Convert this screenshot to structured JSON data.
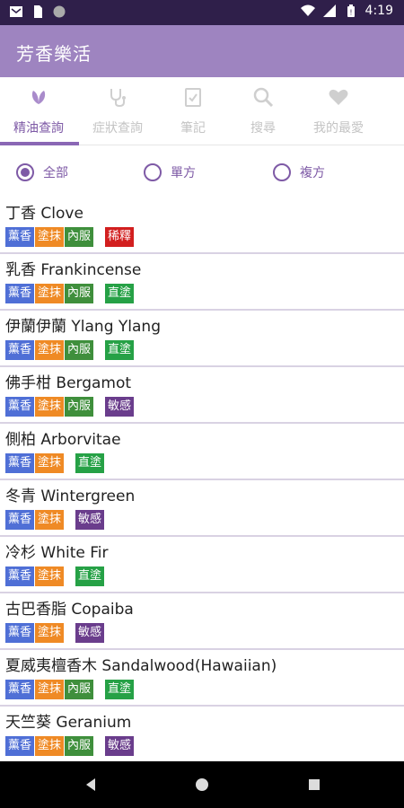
{
  "status_bar": {
    "time": "4:19",
    "left_icons": [
      "mail-icon",
      "sim-card-icon",
      "circle-icon"
    ],
    "right_icons": [
      "wifi-icon",
      "signal-icon",
      "battery-icon"
    ]
  },
  "app_bar": {
    "title": "芳香樂活",
    "color": "#9e84c0"
  },
  "tabs": [
    {
      "label": "精油查詢",
      "icon": "leaf-icon",
      "active": true
    },
    {
      "label": "症狀查詢",
      "icon": "stethoscope-icon",
      "active": false
    },
    {
      "label": "筆記",
      "icon": "notepad-icon",
      "active": false
    },
    {
      "label": "搜尋",
      "icon": "search-icon",
      "active": false
    },
    {
      "label": "我的最愛",
      "icon": "heart-icon",
      "active": false
    }
  ],
  "filter": {
    "options": [
      {
        "label": "全部",
        "checked": true
      },
      {
        "label": "單方",
        "checked": false
      },
      {
        "label": "複方",
        "checked": false
      }
    ]
  },
  "tag_colors": {
    "薰香": "#4f6fd6",
    "塗抹": "#ef8a25",
    "內服": "#3f8f3c",
    "稀釋": "#d21f1f",
    "直塗": "#26a146",
    "敏感": "#6a3d8c"
  },
  "oils": [
    {
      "name": "丁香 Clove",
      "tags": [
        "薰香",
        "塗抹",
        "內服"
      ],
      "note": "稀釋"
    },
    {
      "name": "乳香 Frankincense",
      "tags": [
        "薰香",
        "塗抹",
        "內服"
      ],
      "note": "直塗"
    },
    {
      "name": "伊蘭伊蘭 Ylang Ylang",
      "tags": [
        "薰香",
        "塗抹",
        "內服"
      ],
      "note": "直塗"
    },
    {
      "name": "佛手柑 Bergamot",
      "tags": [
        "薰香",
        "塗抹",
        "內服"
      ],
      "note": "敏感"
    },
    {
      "name": "側柏 Arborvitae",
      "tags": [
        "薰香",
        "塗抹"
      ],
      "note": "直塗"
    },
    {
      "name": "冬青 Wintergreen",
      "tags": [
        "薰香",
        "塗抹"
      ],
      "note": "敏感"
    },
    {
      "name": "冷杉 White Fir",
      "tags": [
        "薰香",
        "塗抹"
      ],
      "note": "直塗"
    },
    {
      "name": "古巴香脂 Copaiba",
      "tags": [
        "薰香",
        "塗抹"
      ],
      "note": "敏感"
    },
    {
      "name": "夏威夷檀香木 Sandalwood(Hawaiian)",
      "tags": [
        "薰香",
        "塗抹",
        "內服"
      ],
      "note": "直塗"
    },
    {
      "name": "天竺葵 Geranium",
      "tags": [
        "薰香",
        "塗抹",
        "內服"
      ],
      "note": "敏感"
    }
  ],
  "nav_bar": {
    "buttons": [
      "back-icon",
      "home-icon",
      "recents-icon"
    ]
  }
}
